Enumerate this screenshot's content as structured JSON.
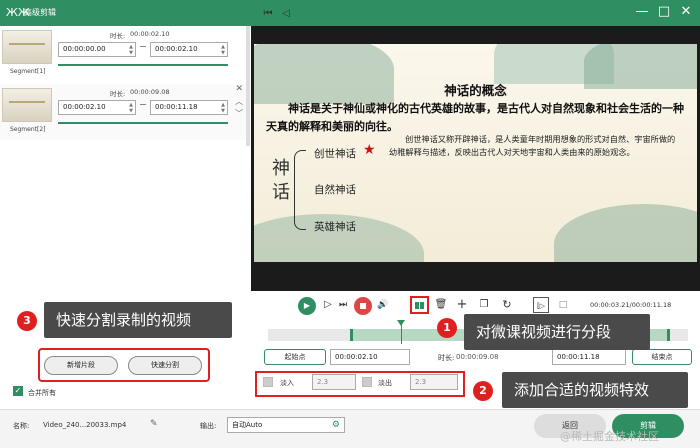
{
  "window": {
    "title": "高级剪辑",
    "logo_glyph": "ЖЖ",
    "minimize": "—",
    "maximize": "□",
    "close": "✕"
  },
  "segments": [
    {
      "label": "Segment[1]",
      "duration_label": "时长:",
      "duration": "00:00:02.10",
      "start": "00:00:00.00",
      "end": "00:00:02.10"
    },
    {
      "label": "Segment[2]",
      "duration_label": "时长:",
      "duration": "00:00:09.08",
      "start": "00:00:02.10",
      "end": "00:00:11.18"
    }
  ],
  "slide": {
    "title": "神话的概念",
    "paragraph": "神话是关于神仙或神化的古代英雄的故事，是古代人对自然现象和社会生活的一种天真的解释和美丽的向往。",
    "big_text": "神话",
    "items": [
      "创世神话",
      "自然神话",
      "英雄神话"
    ],
    "star": "★",
    "description": "创世神话又称开辟神话，是人类童年时期用想象的形式对自然、宇宙所做的幼稚解释与描述，反映出古代人对天地宇宙和人类由来的原始观念。"
  },
  "player": {
    "timecode": "00:00:03.21/00:00:11.18",
    "buttons": {
      "skip_start": "⏮",
      "prev": "◁",
      "play": "▶",
      "next": "▷",
      "stop": "",
      "volume": "🔊",
      "split": "",
      "delete": "🗑",
      "add": "+",
      "copy": "❐",
      "reset": "↻",
      "mark_in": "[▷",
      "mark_out": "□"
    }
  },
  "trim": {
    "start_button": "起始点",
    "start_time": "00:00:02.10",
    "duration_label": "时长:",
    "duration": "00:00:09.08",
    "end_time": "00:00:11.18",
    "end_button": "结束点"
  },
  "effects": {
    "fade_in_label": "淡入",
    "fade_in_value": "2.3",
    "fade_out_label": "淡出",
    "fade_out_value": "2.3"
  },
  "segment_buttons": {
    "new_segment": "新增片段",
    "quick_split": "快速分割"
  },
  "merge": {
    "label": "合并所有",
    "checked": true
  },
  "annotations": [
    {
      "num": "1",
      "text": "对微课视频进行分段"
    },
    {
      "num": "2",
      "text": "添加合适的视频特效"
    },
    {
      "num": "3",
      "text": "快速分割录制的视频"
    }
  ],
  "bottom": {
    "name_label": "名称:",
    "filename": "Video_240...20033.mp4",
    "output_label": "输出:",
    "output_value": "自动Auto",
    "back_button": "返回",
    "edit_button": "剪辑"
  },
  "watermark": "@稀土掘金技术社区",
  "colors": {
    "accent": "#2f8f63",
    "highlight": "#e02020",
    "callout_bg": "#4a4a4a"
  }
}
